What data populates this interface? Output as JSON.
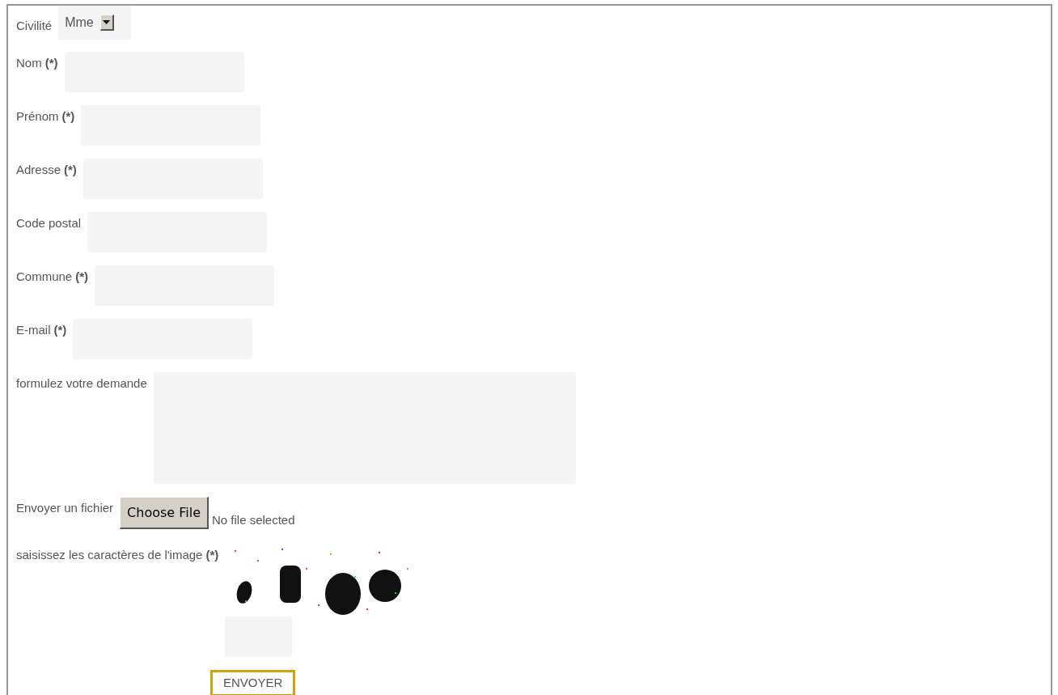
{
  "form": {
    "fields": [
      {
        "kind": "select",
        "label": "Civilité",
        "value": "Mme"
      },
      {
        "kind": "text",
        "label": "Nom",
        "required_mark": "(*)"
      },
      {
        "kind": "text",
        "label": "Prénom",
        "required_mark": "(*)"
      },
      {
        "kind": "text",
        "label": "Adresse",
        "required_mark": "(*)"
      },
      {
        "kind": "text",
        "label": "Code postal"
      },
      {
        "kind": "text",
        "label": "Commune",
        "required_mark": "(*)"
      },
      {
        "kind": "text",
        "label": "E-mail",
        "required_mark": "(*)"
      },
      {
        "kind": "textarea",
        "label": "formulez votre demande"
      },
      {
        "kind": "file",
        "label": "Envoyer un fichier",
        "button": "Choose File",
        "status": "No file selected"
      },
      {
        "kind": "captcha",
        "label": "saisissez les caractères de l'image",
        "required_mark": "(*)"
      }
    ],
    "submit": "ENVOYER"
  }
}
